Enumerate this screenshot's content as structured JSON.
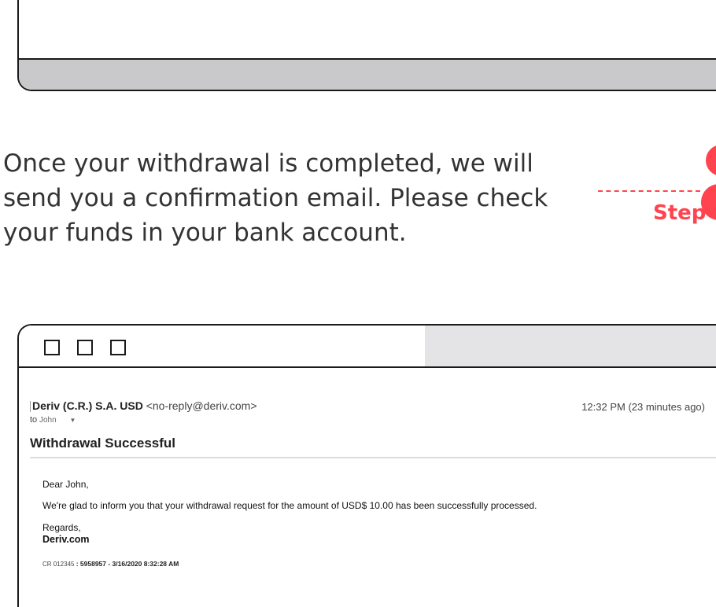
{
  "instruction": {
    "line1": "Once your withdrawal is completed, we will",
    "line2": "send you a confirmation email. Please check",
    "line3": "your funds in your bank account."
  },
  "step": {
    "label": "Step",
    "accent_color": "#ff444f"
  },
  "email": {
    "sender_name": "Deriv (C.R.) S.A. USD",
    "sender_address": "<no-reply@deriv.com>",
    "time": "12:32 PM (23 minutes ago)",
    "to_prefix": "to",
    "to_name": "John",
    "subject": "Withdrawal Successful",
    "greeting_word": "Dear",
    "greeting_name": "John,",
    "message": "We're glad to inform you that your withdrawal request for the amount of USD$ 10.00 has been successfully processed.",
    "regards": "Regards,",
    "signature": "Deriv.com",
    "ref_prefix": "CR 012345",
    "ref_details": ": 5958957 - 3/16/2020 8:32:28 AM"
  },
  "icons": {
    "window_buttons": [
      "square-icon",
      "square-icon",
      "square-icon"
    ],
    "recipient_menu": "caret-down-icon"
  }
}
